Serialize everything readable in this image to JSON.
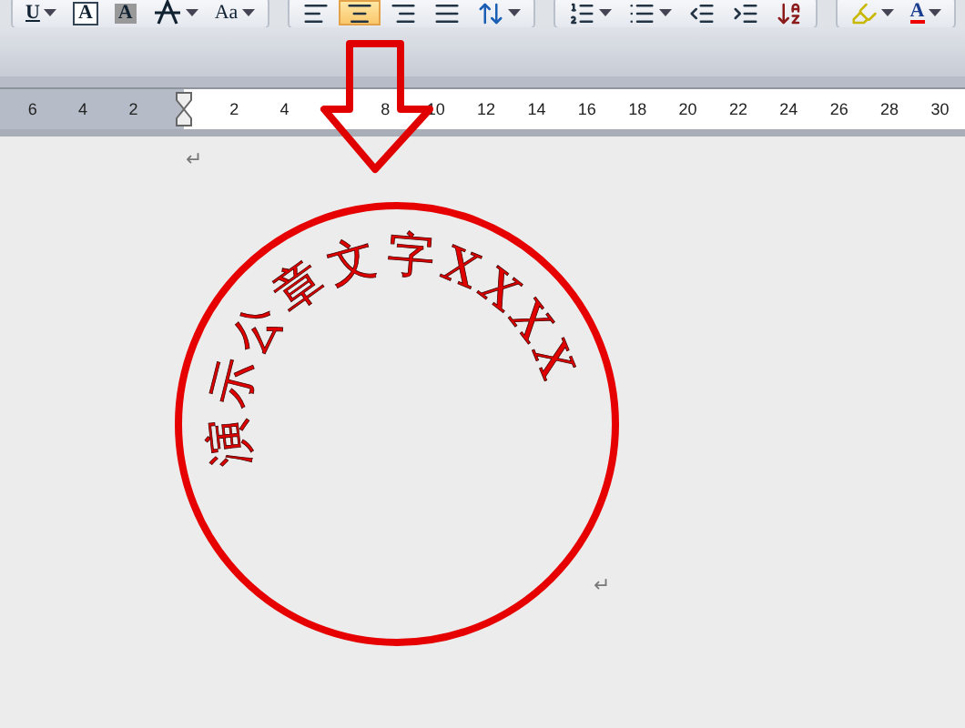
{
  "toolbar": {
    "groups": [
      {
        "buttons": [
          {
            "kind": "underline",
            "label": "U",
            "dropdown": true,
            "selected": false
          },
          {
            "kind": "outline",
            "label": "A",
            "dropdown": false,
            "selected": false
          },
          {
            "kind": "shaded",
            "label": "A",
            "dropdown": false,
            "selected": false
          },
          {
            "kind": "clear",
            "dropdown": true,
            "selected": false
          },
          {
            "kind": "case",
            "label": "Aa",
            "dropdown": true,
            "selected": false
          }
        ]
      },
      {
        "buttons": [
          {
            "kind": "align-left",
            "dropdown": false,
            "selected": false
          },
          {
            "kind": "align-center",
            "dropdown": false,
            "selected": true
          },
          {
            "kind": "align-right",
            "dropdown": false,
            "selected": false
          },
          {
            "kind": "justify",
            "dropdown": false,
            "selected": false
          },
          {
            "kind": "line-spacing",
            "dropdown": true,
            "selected": false
          }
        ]
      },
      {
        "buttons": [
          {
            "kind": "numbering",
            "dropdown": true,
            "selected": false
          },
          {
            "kind": "bullets",
            "dropdown": true,
            "selected": false
          },
          {
            "kind": "outdent",
            "dropdown": false,
            "selected": false
          },
          {
            "kind": "indent",
            "dropdown": false,
            "selected": false
          },
          {
            "kind": "sort",
            "dropdown": false,
            "selected": false
          }
        ]
      },
      {
        "buttons": [
          {
            "kind": "highlight",
            "dropdown": true,
            "selected": false
          },
          {
            "kind": "font-color",
            "label": "A",
            "dropdown": true,
            "selected": false
          }
        ]
      }
    ]
  },
  "ruler": {
    "left_numbers": [
      "6",
      "4",
      "2"
    ],
    "right_numbers": [
      "2",
      "4",
      "8",
      "10",
      "12",
      "14",
      "16",
      "18",
      "20",
      "22",
      "24",
      "26",
      "28",
      "30"
    ]
  },
  "document": {
    "paragraph_marks": [
      "↵",
      "↵"
    ],
    "stamp": {
      "text": "演示公章文字XXXX"
    }
  }
}
